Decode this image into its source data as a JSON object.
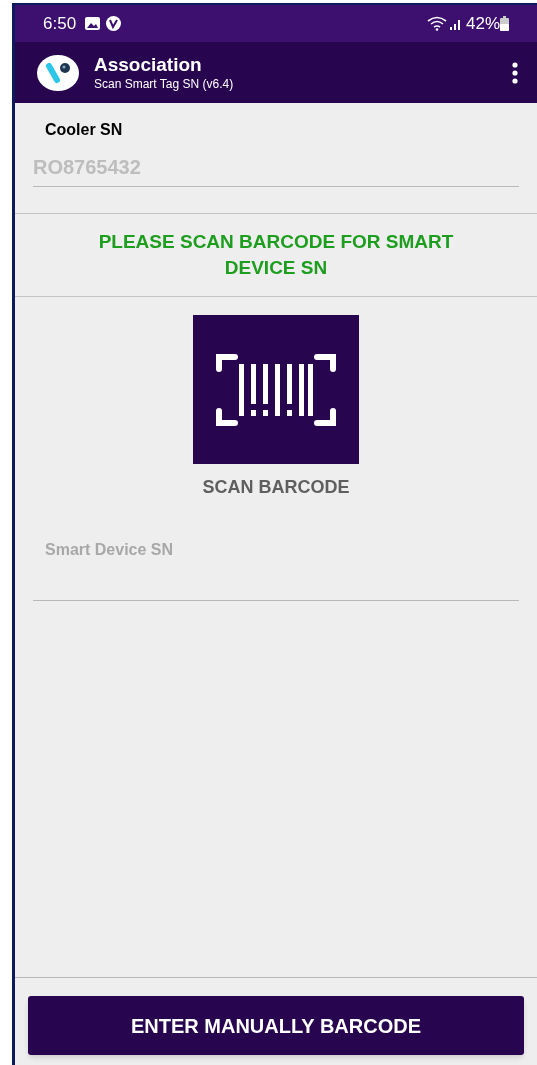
{
  "status_bar": {
    "time": "6:50",
    "battery": "42%"
  },
  "app_bar": {
    "title": "Association",
    "subtitle": "Scan Smart Tag SN (v6.4)"
  },
  "cooler": {
    "label": "Cooler SN",
    "value": "RO8765432"
  },
  "instruction": "PLEASE SCAN BARCODE FOR SMART DEVICE SN",
  "scan_button": {
    "label": "SCAN BARCODE"
  },
  "smart_device_field": {
    "placeholder": "Smart Device SN"
  },
  "bottom_button": {
    "label": "ENTER MANUALLY BARCODE"
  }
}
